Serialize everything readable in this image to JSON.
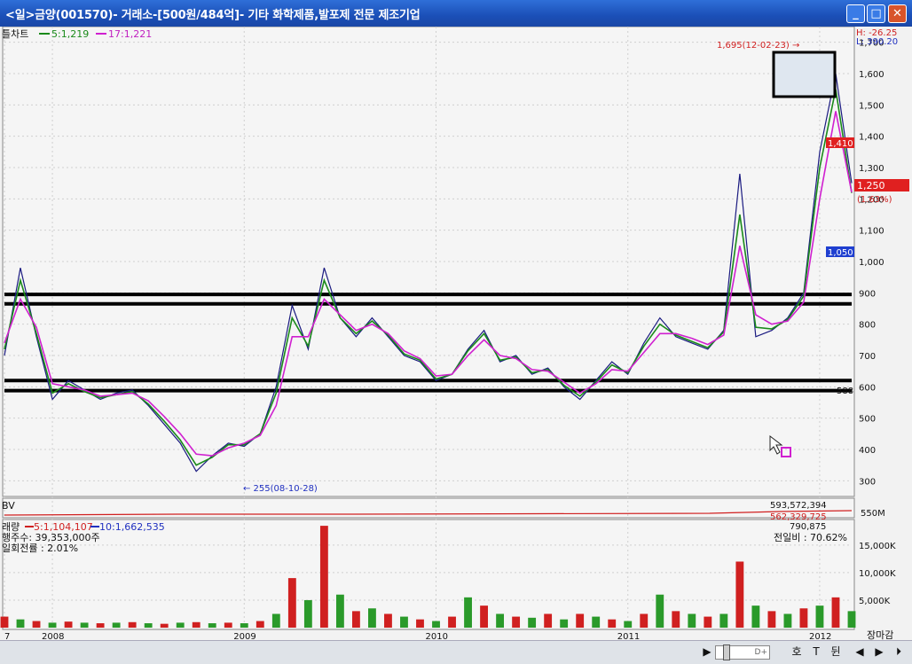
{
  "window": {
    "title": "<일>금양(001570)- 거래소-[500원/484억]- 기타 화학제품,발포제 전문 제조기업",
    "btn_min": "_",
    "btn_max": "□",
    "btn_close": "✕"
  },
  "price_panel": {
    "legend_label": "틀차트",
    "ma5_label": "5:1,219",
    "ma17_label": "17:1,221",
    "high_box": "H: -26.25",
    "low_box": "L: 390.20",
    "high_annotation": "1,695(12-02-23) →",
    "low_annotation": "← 255(08-10-28)",
    "tag_1410": "1,410",
    "tag_current": "1,250",
    "tag_change": "(1.63%)",
    "tag_1050": "1,050",
    "label_588": "588",
    "yticks": [
      "1,700",
      "1,600",
      "1,500",
      "1,400",
      "1,300",
      "1,200",
      "1,100",
      "1,000",
      "900",
      "800",
      "700",
      "600",
      "500",
      "400",
      "300"
    ]
  },
  "obv_panel": {
    "label": "BV",
    "value1": "593,572,394",
    "value2": "562,329,725",
    "scale": "550M"
  },
  "volume_panel": {
    "legend_title": "래량",
    "legend_ma5": "5:1,104,107",
    "legend_ma10": "10:1,662,535",
    "shares": "행주수: 39,353,000주",
    "turnover": "일회전률 : 2.01%",
    "value": "790,875",
    "ratio": "전일비 : 70.62%",
    "yticks": [
      "15,000K",
      "10,000K",
      "5,000K"
    ]
  },
  "x_axis": {
    "ticks": [
      "7",
      "2008",
      "2009",
      "2010",
      "2011",
      "2012"
    ],
    "right_label": "장마감"
  },
  "toolbar": {
    "play": "▶",
    "zoom_label": "D+",
    "ho": "호",
    "filter": "T",
    "win": "뒨",
    "left": "◀",
    "right": "▶",
    "end": "⏵"
  },
  "chart_data": {
    "type": "line",
    "title": "",
    "x": [
      "2007-10",
      "2007-11",
      "2007-12",
      "2008-01",
      "2008-02",
      "2008-03",
      "2008-04",
      "2008-05",
      "2008-06",
      "2008-07",
      "2008-08",
      "2008-09",
      "2008-10",
      "2008-11",
      "2008-12",
      "2009-01",
      "2009-02",
      "2009-03",
      "2009-04",
      "2009-05",
      "2009-06",
      "2009-07",
      "2009-08",
      "2009-09",
      "2009-10",
      "2009-11",
      "2009-12",
      "2010-01",
      "2010-02",
      "2010-03",
      "2010-04",
      "2010-05",
      "2010-06",
      "2010-07",
      "2010-08",
      "2010-09",
      "2010-10",
      "2010-11",
      "2010-12",
      "2011-01",
      "2011-02",
      "2011-03",
      "2011-04",
      "2011-05",
      "2011-06",
      "2011-07",
      "2011-08",
      "2011-09",
      "2011-10",
      "2011-11",
      "2011-12",
      "2012-01",
      "2012-02",
      "2012-03"
    ],
    "series": [
      {
        "name": "",
        "values": [
          700,
          980,
          760,
          560,
          620,
          590,
          560,
          580,
          590,
          540,
          480,
          420,
          330,
          380,
          420,
          410,
          450,
          600,
          860,
          720,
          980,
          820,
          760,
          820,
          760,
          700,
          680,
          620,
          640,
          720,
          780,
          680,
          700,
          640,
          660,
          600,
          560,
          620,
          680,
          640,
          740,
          820,
          760,
          740,
          720,
          780,
          1280,
          760,
          780,
          820,
          900,
          1350,
          1600,
          1250
        ]
      },
      {
        "name": "5",
        "values": [
          720,
          940,
          770,
          580,
          610,
          585,
          565,
          575,
          585,
          545,
          490,
          430,
          350,
          375,
          415,
          415,
          450,
          580,
          820,
          730,
          940,
          820,
          770,
          810,
          765,
          705,
          685,
          625,
          640,
          715,
          770,
          685,
          695,
          645,
          655,
          605,
          570,
          615,
          670,
          645,
          730,
          800,
          765,
          745,
          725,
          775,
          1150,
          790,
          785,
          815,
          890,
          1300,
          1550,
          1219
        ]
      },
      {
        "name": "17",
        "values": [
          740,
          880,
          790,
          610,
          600,
          590,
          570,
          575,
          580,
          555,
          505,
          450,
          385,
          380,
          405,
          420,
          445,
          540,
          760,
          760,
          880,
          830,
          780,
          800,
          770,
          715,
          690,
          635,
          640,
          700,
          750,
          700,
          690,
          655,
          650,
          615,
          580,
          610,
          655,
          650,
          710,
          770,
          770,
          755,
          735,
          765,
          1050,
          830,
          800,
          810,
          870,
          1200,
          1480,
          1221
        ]
      }
    ],
    "volume_values_k": [
      2000,
      1500,
      1200,
      900,
      1100,
      900,
      800,
      900,
      1000,
      800,
      700,
      900,
      1000,
      800,
      900,
      800,
      1200,
      2500,
      9000,
      5000,
      18500,
      6000,
      3000,
      3500,
      2500,
      2000,
      1500,
      1200,
      2000,
      5500,
      4000,
      2500,
      2000,
      1800,
      2500,
      1500,
      2500,
      2000,
      1500,
      1200,
      2500,
      6000,
      3000,
      2500,
      2000,
      2500,
      12000,
      4000,
      3000,
      2500,
      3500,
      4000,
      5500,
      3000
    ],
    "ylim": [
      250,
      1750
    ],
    "volume_ylim": [
      0,
      19000
    ],
    "horizontal_levels": [
      895,
      865,
      620,
      588
    ],
    "xlabel": "",
    "ylabel": "",
    "grid": true
  }
}
